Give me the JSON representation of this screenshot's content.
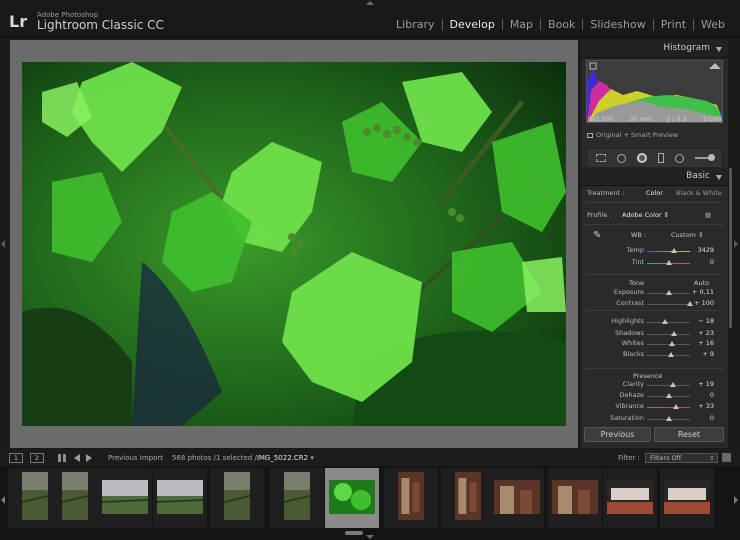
{
  "app": {
    "brand_short": "Lr",
    "brand_sub": "Adobe Photoshop",
    "brand_main": "Lightroom Classic CC"
  },
  "modules": [
    {
      "label": "Library",
      "active": false
    },
    {
      "label": "Develop",
      "active": true
    },
    {
      "label": "Map",
      "active": false
    },
    {
      "label": "Book",
      "active": false
    },
    {
      "label": "Slideshow",
      "active": false
    },
    {
      "label": "Print",
      "active": false
    },
    {
      "label": "Web",
      "active": false
    }
  ],
  "histogram": {
    "title": "Histogram",
    "iso": "ISO 100",
    "focal": "35 mm",
    "aperture": "ƒ / 6.3",
    "shutter": "1/160",
    "preview_label": "Original + Smart Preview"
  },
  "basic": {
    "title": "Basic",
    "treatment_label": "Treatment :",
    "treatment_color": "Color",
    "treatment_bw": "Black & White",
    "profile_label": "Profile :",
    "profile_value": "Adobe Color",
    "wb_label": "WB :",
    "wb_value": "Custom",
    "tone_label": "Tone",
    "auto_label": "Auto",
    "presence_label": "Presence",
    "sliders": [
      {
        "name": "Temp",
        "value": "3429",
        "pos": 0.62
      },
      {
        "name": "Tint",
        "value": "0",
        "pos": 0.5
      },
      {
        "name": "Exposure",
        "value": "+ 0,11",
        "pos": 0.52
      },
      {
        "name": "Contrast",
        "value": "+ 100",
        "pos": 1.0
      },
      {
        "name": "Highlights",
        "value": "− 18",
        "pos": 0.41
      },
      {
        "name": "Shadows",
        "value": "+ 23",
        "pos": 0.62
      },
      {
        "name": "Whites",
        "value": "+ 16",
        "pos": 0.58
      },
      {
        "name": "Blacks",
        "value": "+ 9",
        "pos": 0.55
      },
      {
        "name": "Clarity",
        "value": "+ 19",
        "pos": 0.6
      },
      {
        "name": "Dehaze",
        "value": "0",
        "pos": 0.5
      },
      {
        "name": "Vibrance",
        "value": "+ 33",
        "pos": 0.67
      },
      {
        "name": "Saturation",
        "value": "0",
        "pos": 0.5
      }
    ]
  },
  "buttons": {
    "previous": "Previous",
    "reset": "Reset"
  },
  "filmstrip_bar": {
    "monitor1": "1",
    "monitor2": "2",
    "source": "Previous Import",
    "count": "568 photos /1 selected /",
    "filename": "IMG_5022.CR2",
    "filter_label": "Filter :",
    "filter_value": "Filters Off"
  },
  "filmstrip": [
    {
      "kind": "vineyard",
      "orient": "port"
    },
    {
      "kind": "vineyard",
      "orient": "port"
    },
    {
      "kind": "field",
      "orient": "land"
    },
    {
      "kind": "field",
      "orient": "land"
    },
    {
      "kind": "vineyard",
      "orient": "port"
    },
    {
      "kind": "vineyard",
      "orient": "port"
    },
    {
      "kind": "leaves",
      "orient": "land",
      "selected": true
    },
    {
      "kind": "cellar",
      "orient": "port"
    },
    {
      "kind": "cellar",
      "orient": "port"
    },
    {
      "kind": "cellar",
      "orient": "land"
    },
    {
      "kind": "cellar",
      "orient": "land"
    },
    {
      "kind": "cellar2",
      "orient": "land"
    },
    {
      "kind": "cellar2",
      "orient": "land"
    }
  ]
}
